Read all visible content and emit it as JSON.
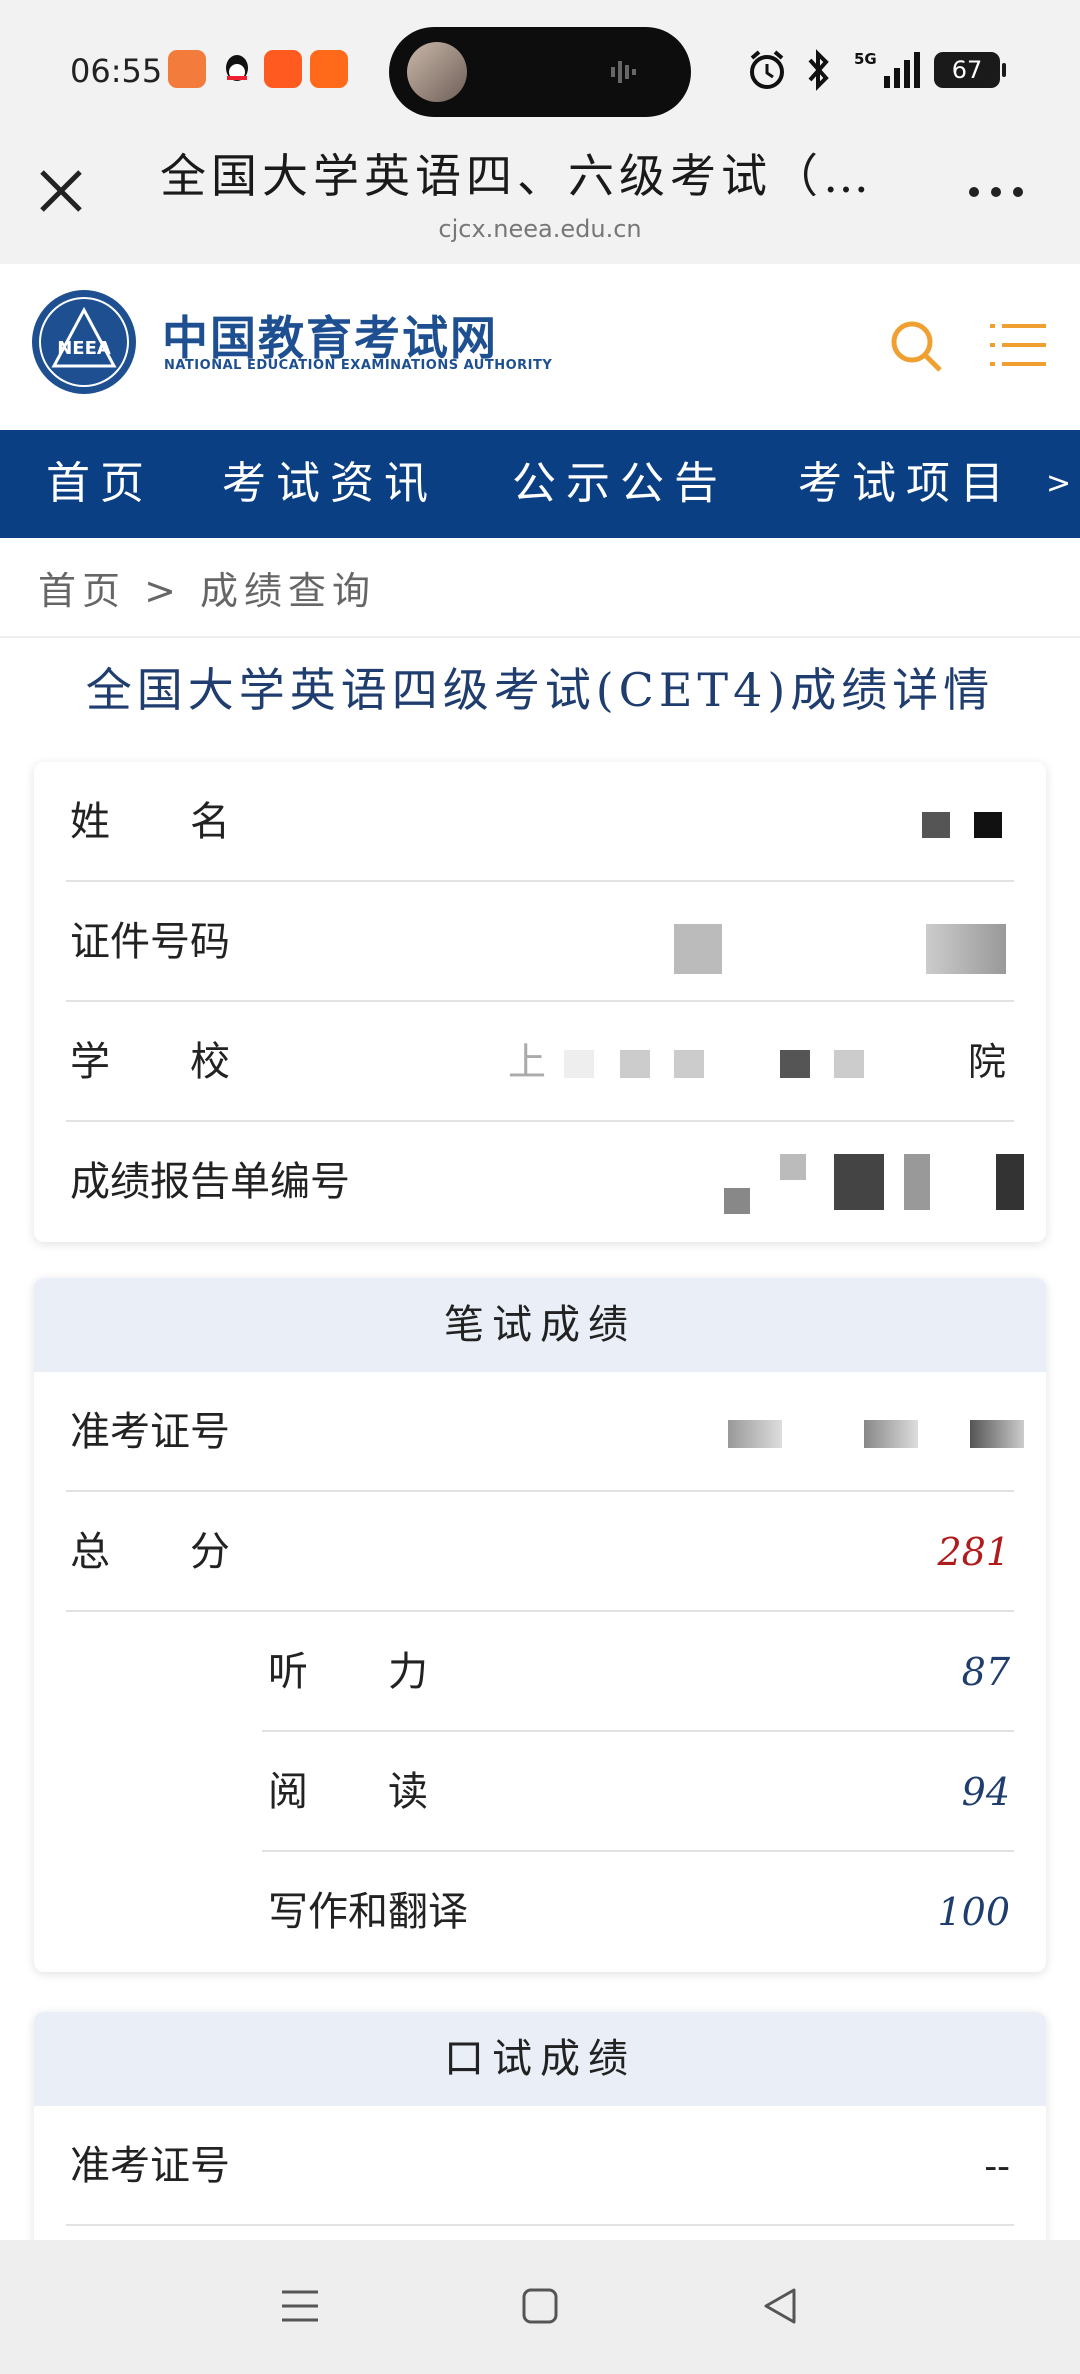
{
  "status": {
    "time": "06:55",
    "battery": "67"
  },
  "browser": {
    "title": "全国大学英语四、六级考试（…",
    "url": "cjcx.neea.edu.cn"
  },
  "site": {
    "brand_cn": "中国教育考试网",
    "brand_en": "NATIONAL EDUCATION EXAMINATIONS AUTHORITY",
    "logo_text": "NEEA",
    "nav": [
      "首页",
      "考试资讯",
      "公示公告",
      "考试项目"
    ],
    "breadcrumb": "首页 > 成绩查询"
  },
  "page_title": "全国大学英语四级考试(CET4)成绩详情",
  "info": {
    "name_label": "姓　　名",
    "id_label": "证件号码",
    "school_label": "学　　校",
    "school_partial_first": "上",
    "school_partial_last": "院",
    "report_label": "成绩报告单编号"
  },
  "written": {
    "header": "笔试成绩",
    "ticket_label": "准考证号",
    "total_label": "总　　分",
    "total": "281",
    "items": [
      {
        "label": "听　　力",
        "value": "87"
      },
      {
        "label": "阅　　读",
        "value": "94"
      },
      {
        "label": "写作和翻译",
        "value": "100"
      }
    ]
  },
  "oral": {
    "header": "口试成绩",
    "ticket_label": "准考证号",
    "ticket_value": "--"
  },
  "colors": {
    "nav_bg": "#0a3f83",
    "brand": "#1d4f91",
    "score_total": "#b01b1b",
    "accent_search": "#f0a030"
  }
}
